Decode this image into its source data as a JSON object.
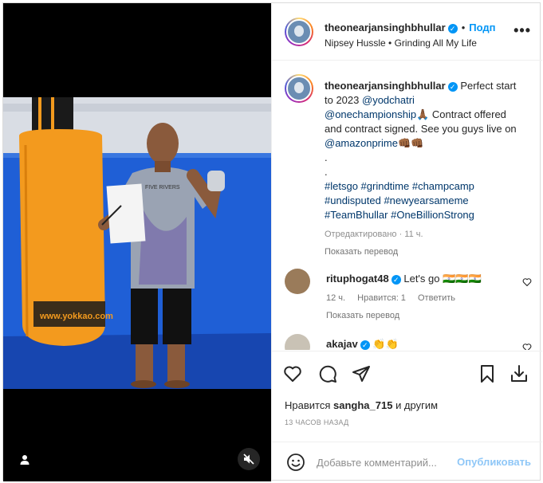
{
  "post": {
    "author": "theonearjansinghbhullar",
    "follow_label": "Подп",
    "separator": "•",
    "audio": "Nipsey Hussle • Grinding All My Life",
    "caption_lines": [
      "Perfect start to 2023",
      "@yodchatri",
      "@onechampionship",
      "Contract offered and contract signed. See you guys live on",
      "@amazonprime",
      ".",
      ".",
      "#letsgo #grindtime #champcamp",
      "#undisputed #newyearsameme",
      "#TeamBhullar #OneBillionStrong"
    ],
    "edited_meta": "Отредактировано · 11 ч.",
    "translate": "Показать перевод"
  },
  "comments": [
    {
      "user": "rituphogat48",
      "text": "Let's go",
      "emoji": "🇮🇳🇮🇳🇮🇳",
      "time": "12 ч.",
      "likes": "Нравится: 1",
      "reply": "Ответить",
      "translate": "Показать перевод"
    },
    {
      "user": "akajav",
      "text": "",
      "emoji": "👏👏"
    }
  ],
  "actions": {
    "icons": [
      "heart-icon",
      "comment-icon",
      "share-icon",
      "bookmark-icon",
      "download-icon"
    ]
  },
  "likes": {
    "prefix": "Нравится",
    "user": "sangha_715",
    "suffix": "и другим"
  },
  "time_ago": "13 ЧАСОВ НАЗАД",
  "add_comment": {
    "placeholder": "Добавьте комментарий...",
    "publish": "Опубликовать"
  },
  "photo": {
    "bag_text": "www.yokkao.com",
    "shirt_text": "FIVE RIVERS"
  },
  "colors": {
    "accent": "#0095f6",
    "link": "#00376b",
    "publish_disabled": "#8fc7f7",
    "bag": "#f39a1e",
    "wall": "#1f5fd6"
  }
}
